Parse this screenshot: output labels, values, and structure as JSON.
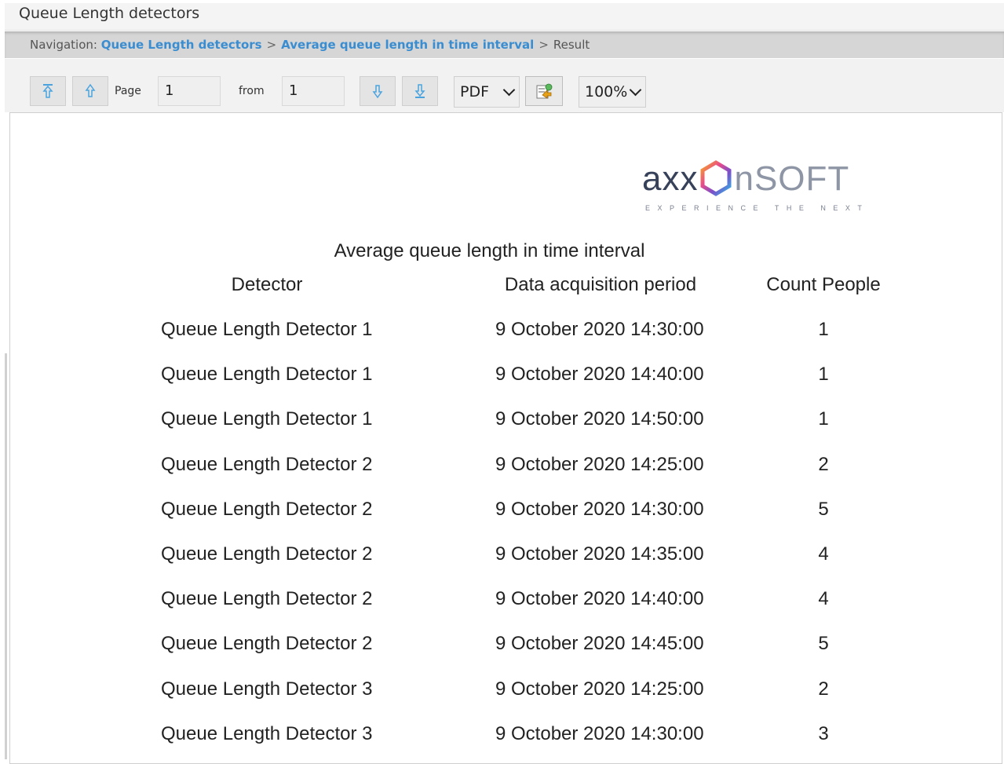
{
  "window": {
    "title": "Queue Length detectors"
  },
  "navigation": {
    "prefix": "Navigation:",
    "crumbs": [
      {
        "label": "Queue Length detectors"
      },
      {
        "label": "Average queue length in time interval"
      },
      {
        "label": "Result"
      }
    ],
    "separator": ">"
  },
  "toolbar": {
    "page_label": "Page",
    "page_value": "1",
    "from_label": "from",
    "from_value": "1",
    "format_selected": "PDF",
    "zoom_selected": "100%"
  },
  "report": {
    "logo_main": "axx",
    "logo_soft": "nSOFT",
    "logo_tagline": "EXPERIENCE THE NEXT",
    "title": "Average queue length in time interval",
    "columns": [
      "Detector",
      "Data acquisition period",
      "Count People"
    ],
    "rows": [
      [
        "Queue Length Detector 1",
        "9 October 2020 14:30:00",
        "1"
      ],
      [
        "Queue Length Detector 1",
        "9 October 2020 14:40:00",
        "1"
      ],
      [
        "Queue Length Detector 1",
        "9 October 2020 14:50:00",
        "1"
      ],
      [
        "Queue Length Detector 2",
        "9 October 2020 14:25:00",
        "2"
      ],
      [
        "Queue Length Detector 2",
        "9 October 2020 14:30:00",
        "5"
      ],
      [
        "Queue Length Detector 2",
        "9 October 2020 14:35:00",
        "4"
      ],
      [
        "Queue Length Detector 2",
        "9 October 2020 14:40:00",
        "4"
      ],
      [
        "Queue Length Detector 2",
        "9 October 2020 14:45:00",
        "5"
      ],
      [
        "Queue Length Detector 3",
        "9 October 2020 14:25:00",
        "2"
      ],
      [
        "Queue Length Detector 3",
        "9 October 2020 14:30:00",
        "3"
      ]
    ]
  },
  "colors": {
    "nav_link": "#3a8dd0",
    "toolbar_arrow": "#4aa3df"
  },
  "icons": {
    "first_page": "arrow-up-to-top-icon",
    "prev_page": "arrow-up-icon",
    "next_page": "arrow-down-icon",
    "last_page": "arrow-down-to-bottom-icon",
    "export": "export-icon"
  }
}
